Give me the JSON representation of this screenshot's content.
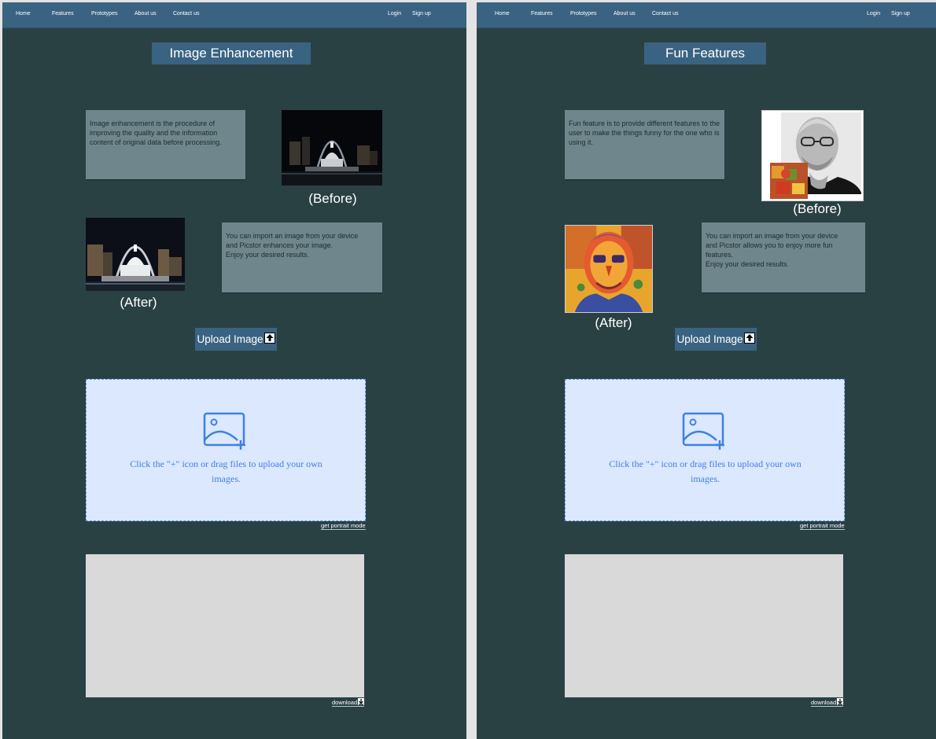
{
  "nav": {
    "left_items": [
      "Home",
      "Features",
      "Prototypes",
      "About us",
      "Contact us"
    ],
    "right_items": [
      "Login",
      "Sign up"
    ]
  },
  "panels": [
    {
      "title": "Image Enhancement",
      "description_1": "Image enhancement is the procedure of improving the quality and the information content of original data before processing.",
      "description_2": "You can import an image from your device\nand Picstor enhances your image.\nEnjoy your desired results.",
      "before_caption": "(Before)",
      "after_caption": "(After)",
      "upload_button": "Upload Image",
      "dropzone_text": "Click the \"+\" icon or drag files to upload your own images.",
      "portrait_link": "get portrait mode",
      "download_link": "download"
    },
    {
      "title": "Fun Features",
      "description_1": "Fun feature is to provide different features to the user to make the things funny for the one who is using it.",
      "description_2": "You can import an image from your device\nand Picstor allows you to enjoy more fun features.\nEnjoy your desired results.",
      "before_caption": "(Before)",
      "after_caption": "(After)",
      "upload_button": "Upload Image",
      "dropzone_text": "Click the \"+\" icon or drag files to upload your own images.",
      "portrait_link": "get portrait mode",
      "download_link": "download"
    }
  ],
  "icons": {
    "upload": "upload-arrow-icon",
    "image_add": "image-add-icon",
    "download": "download-arrow-icon"
  },
  "colors": {
    "page_background": "#2a4144",
    "nav_bar": "#3a6382",
    "description_box": "#6f878c",
    "dropzone_fill": "#dbe8fd",
    "dropzone_accent": "#3f7fe7",
    "result_box": "#d9d9d9"
  }
}
